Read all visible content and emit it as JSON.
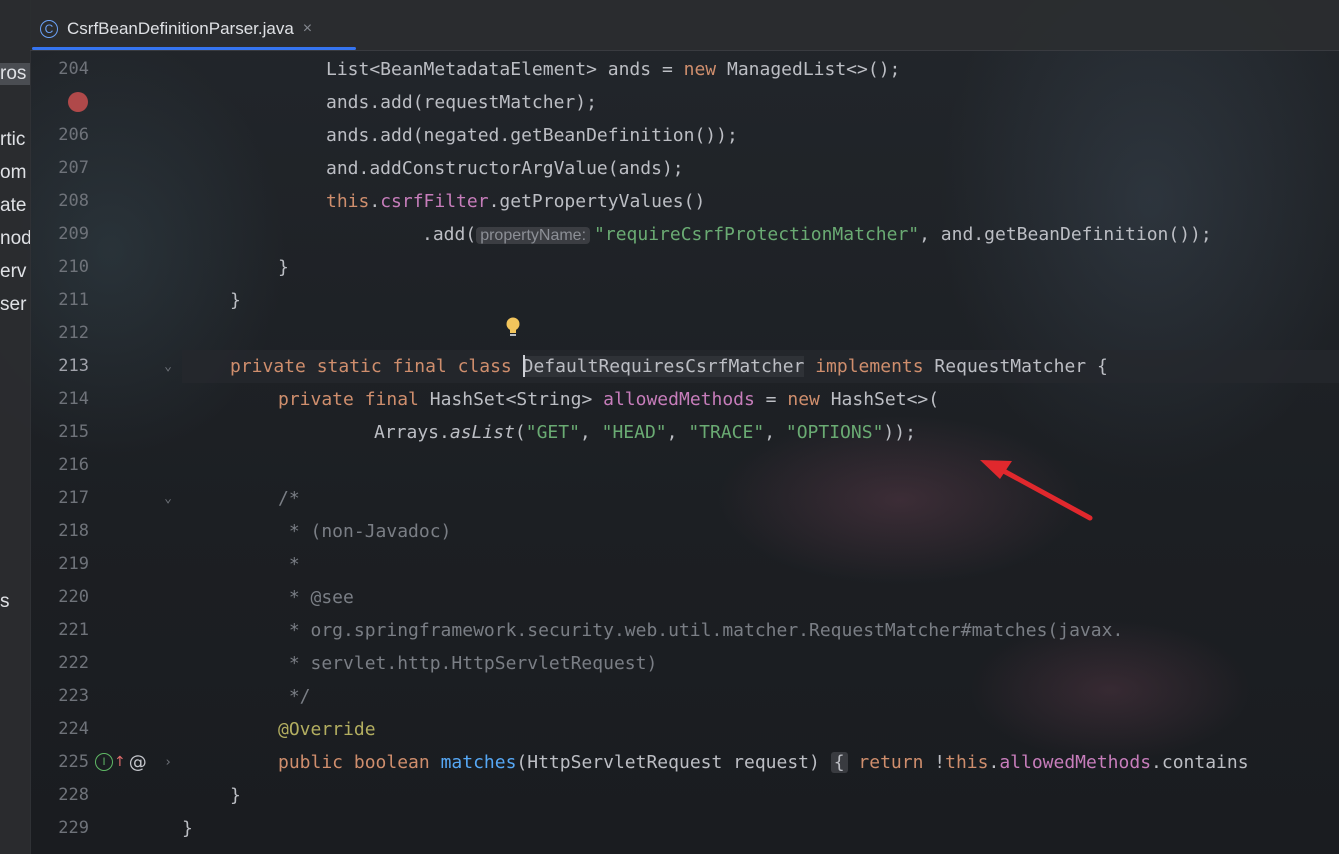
{
  "tab": {
    "title": "CsrfBeanDefinitionParser.java",
    "close": "×",
    "icon": "class-icon",
    "icon_glyph": "C"
  },
  "left_pane_fragments": [
    "ros",
    "rtic",
    "om",
    "ate",
    "nod",
    "erv",
    "ser",
    "s"
  ],
  "line_numbers": [
    "204",
    "",
    "206",
    "207",
    "208",
    "209",
    "210",
    "211",
    "212",
    "213",
    "214",
    "215",
    "216",
    "217",
    "218",
    "219",
    "220",
    "221",
    "222",
    "223",
    "224",
    "225",
    "228",
    "229"
  ],
  "code": {
    "l204": {
      "a": "List<BeanMetadataElement> ands = ",
      "b": "new",
      "c": " ManagedList<>();"
    },
    "l205": "ands.add(requestMatcher);",
    "l206": "ands.add(negated.getBeanDefinition());",
    "l207": "and.addConstructorArgValue(ands);",
    "l208": {
      "a": "this",
      "b": ".",
      "c": "csrfFilter",
      "d": ".getPropertyValues()"
    },
    "l209": {
      "a": ".add(",
      "hint": "propertyName:",
      "str": "\"requireCsrfProtectionMatcher\"",
      "b": ", and.getBeanDefinition());"
    },
    "l210": "}",
    "l211": "}",
    "l213": {
      "kw": "private static final class ",
      "name": "DefaultRequiresCsrfMatcher",
      "impl": " implements",
      "rest": " RequestMatcher {"
    },
    "l214": {
      "kw": "private final",
      "a": " HashSet<String> ",
      "fld": "allowedMethods",
      "b": " = ",
      "kw2": "new",
      "c": " HashSet<>("
    },
    "l215": {
      "a": "Arrays.",
      "m": "asList",
      "b": "(",
      "s1": "\"GET\"",
      "s2": "\"HEAD\"",
      "s3": "\"TRACE\"",
      "s4": "\"OPTIONS\"",
      "sep": ", ",
      "c": "));"
    },
    "l217": "/*",
    "l218": " * (non-Javadoc)",
    "l219": " *",
    "l220": " * @see",
    "l221": " * org.springframework.security.web.util.matcher.RequestMatcher#matches(javax.",
    "l222": " * servlet.http.HttpServletRequest)",
    "l223": " */",
    "l224": "@Override",
    "l225": {
      "kw": "public boolean",
      "sp": " ",
      "m": "matches",
      "a": "(HttpServletRequest request)",
      "brace": "{",
      "ret": "return",
      "b": " !",
      "this": "this",
      "dot": ".",
      "fld": "allowedMethods",
      "c": ".contains"
    },
    "l228": "}",
    "l229": "}"
  },
  "colors": {
    "accent": "#3574f0",
    "keyword": "#cf8e6d",
    "string": "#6aab73",
    "field": "#c77dbb",
    "method": "#56a8f5",
    "annotation_arrow": "#e0282d"
  }
}
